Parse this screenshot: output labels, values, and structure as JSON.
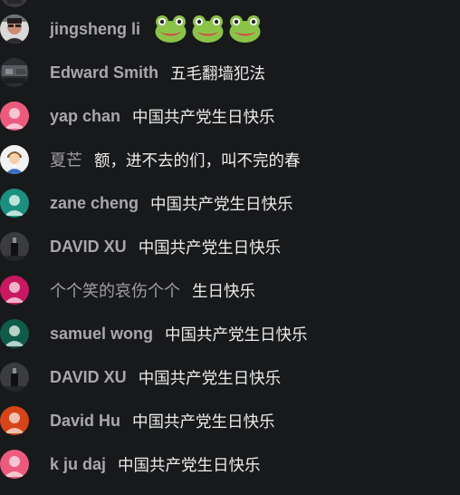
{
  "chat": {
    "messages": [
      {
        "author": "",
        "text": "",
        "avatar": "photo-dark",
        "clipped": true
      },
      {
        "author": "jingsheng li",
        "text": "",
        "avatar": "photo-person",
        "emojis": [
          "frog-emoji",
          "frog-emoji",
          "frog-emoji"
        ]
      },
      {
        "author": "Edward Smith",
        "text": "五毛翻墙犯法",
        "avatar": "photo-dark"
      },
      {
        "author": "yap chan",
        "text": "中国共产党生日快乐",
        "avatar": "default-pink"
      },
      {
        "author": "夏芒",
        "text": "额，进不去的们，叫不完的春",
        "avatar": "cartoon-person"
      },
      {
        "author": "zane cheng",
        "text": "中国共产党生日快乐",
        "avatar": "default-teal"
      },
      {
        "author": "DAVID XU",
        "text": "中国共产党生日快乐",
        "avatar": "photo-dark"
      },
      {
        "author": "个个笑的哀伤个个",
        "text": "生日快乐",
        "avatar": "default-magenta"
      },
      {
        "author": "samuel wong",
        "text": "中国共产党生日快乐",
        "avatar": "default-darkgreen"
      },
      {
        "author": "DAVID XU",
        "text": "中国共产党生日快乐",
        "avatar": "photo-dark"
      },
      {
        "author": "David Hu",
        "text": "中国共产党生日快乐",
        "avatar": "default-orange"
      },
      {
        "author": "k ju daj",
        "text": "中国共产党生日快乐",
        "avatar": "default-pink"
      }
    ]
  },
  "colors": {
    "background": "#18191b",
    "author": "#a8a8ab",
    "message": "#ececec",
    "default-pink": "#ec5b7e",
    "default-teal": "#1b8f80",
    "default-magenta": "#c8185f",
    "default-darkgreen": "#0f5a48",
    "default-orange": "#d6451a",
    "frog": "#8bc34a"
  }
}
